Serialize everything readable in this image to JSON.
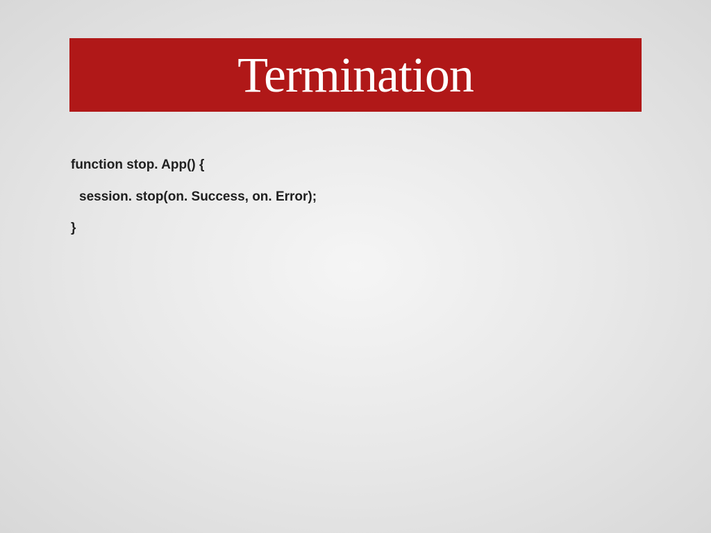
{
  "slide": {
    "title": "Termination",
    "code": {
      "line1": "function stop. App() {",
      "line2": "session. stop(on. Success, on. Error);",
      "line3": "}"
    }
  }
}
